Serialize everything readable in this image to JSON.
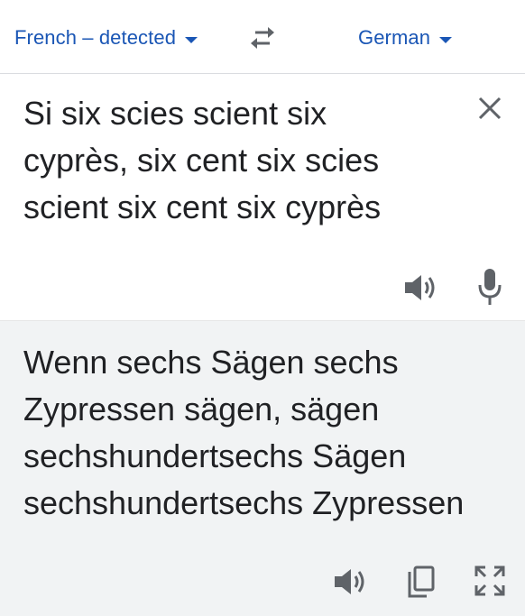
{
  "languages": {
    "source": "French – detected",
    "target": "German"
  },
  "icons": {
    "swap": "swap-arrows-icon",
    "clear": "close-icon",
    "speaker": "speaker-icon",
    "mic": "microphone-icon",
    "copy": "copy-icon",
    "fullscreen": "fullscreen-icon"
  },
  "source": {
    "lines": [
      "Si six scies scient six",
      "cyprès, six cent six scies",
      "scient six cent six cyprès"
    ]
  },
  "result": {
    "lines": [
      "Wenn sechs Sägen sechs",
      "Zypressen sägen, sägen",
      "sechshundertsechs Sägen",
      "sechshundertsechs Zypressen"
    ]
  },
  "colors": {
    "accent": "#1a56b5",
    "icon": "#5f6368",
    "result_bg": "#f1f3f4"
  }
}
